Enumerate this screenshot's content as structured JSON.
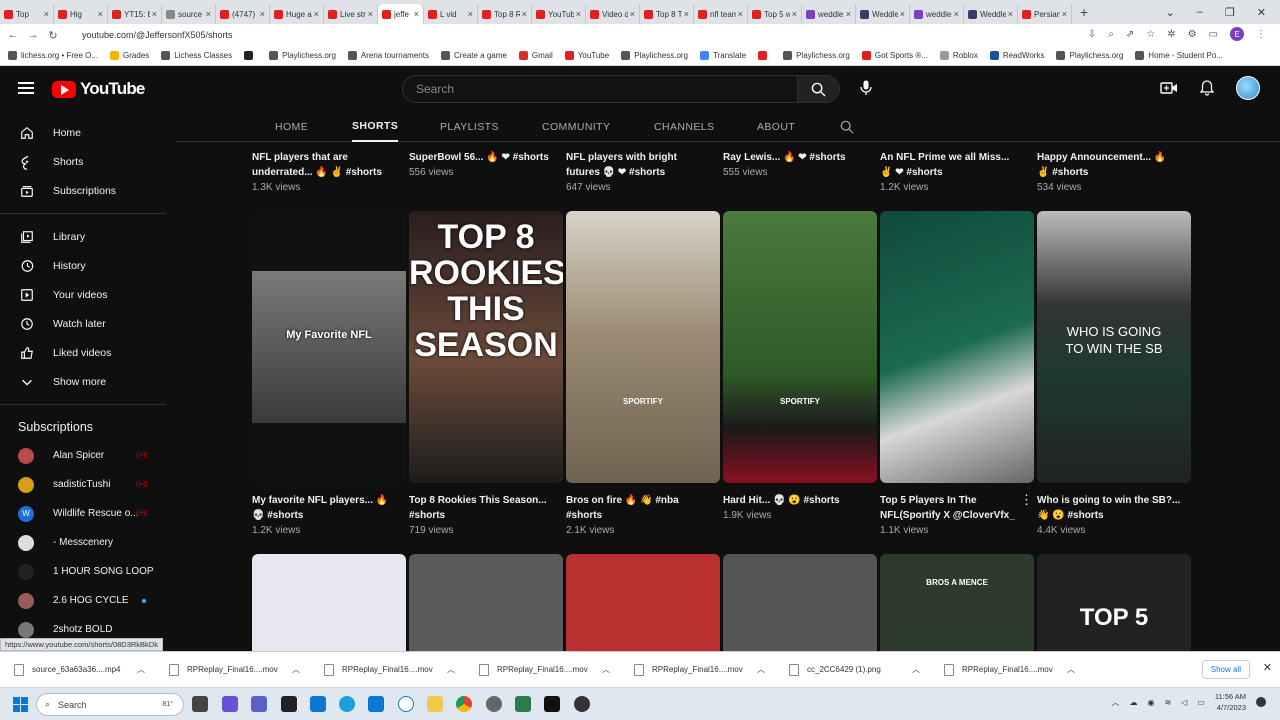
{
  "browser": {
    "tabs": [
      {
        "title": "Top",
        "color": "#e02020"
      },
      {
        "title": "Hig",
        "color": "#e02020"
      },
      {
        "title": "YT15: E",
        "color": "#e02020"
      },
      {
        "title": "source",
        "color": "#888888"
      },
      {
        "title": "(4747)",
        "color": "#e02020"
      },
      {
        "title": "Huge a",
        "color": "#e02020"
      },
      {
        "title": "Live stre",
        "color": "#e02020"
      },
      {
        "title": "jeffe",
        "color": "#e02020",
        "active": true
      },
      {
        "title": "L vid",
        "color": "#e02020"
      },
      {
        "title": "Top 8 R",
        "color": "#e02020"
      },
      {
        "title": "YouTub",
        "color": "#e02020"
      },
      {
        "title": "Video d",
        "color": "#e02020"
      },
      {
        "title": "Top 8 T",
        "color": "#e02020"
      },
      {
        "title": "nfl team",
        "color": "#e02020"
      },
      {
        "title": "Top 5 w",
        "color": "#e02020"
      },
      {
        "title": "weddle",
        "color": "#7b3fc6"
      },
      {
        "title": "Weddle",
        "color": "#3b3b6b"
      },
      {
        "title": "weddle",
        "color": "#7b3fc6"
      },
      {
        "title": "Weddle",
        "color": "#3b3b6b"
      },
      {
        "title": "Persian",
        "color": "#e02020"
      }
    ],
    "url": "youtube.com/@JeffersonfX505/shorts",
    "profile_initial": "E",
    "bookmarks": [
      {
        "label": "lichess.org • Free O...",
        "color": "#555555"
      },
      {
        "label": "Grades",
        "color": "#f4b400"
      },
      {
        "label": "Lichess Classes",
        "color": "#555555"
      },
      {
        "label": "",
        "color": "#222222"
      },
      {
        "label": "Playlichess.org",
        "color": "#555555"
      },
      {
        "label": "Arena tournaments",
        "color": "#555555"
      },
      {
        "label": "Create a game",
        "color": "#555555"
      },
      {
        "label": "Gmail",
        "color": "#d93025"
      },
      {
        "label": "YouTube",
        "color": "#e02020"
      },
      {
        "label": "Playlichess.org",
        "color": "#555555"
      },
      {
        "label": "Translate",
        "color": "#4285f4"
      },
      {
        "label": "",
        "color": "#e02020"
      },
      {
        "label": "Playlichess.org",
        "color": "#555555"
      },
      {
        "label": "Got Sports ®...",
        "color": "#e02020"
      },
      {
        "label": "Roblox",
        "color": "#999999"
      },
      {
        "label": "ReadWorks",
        "color": "#1a4f9c"
      },
      {
        "label": "Playlichess.org",
        "color": "#555555"
      },
      {
        "label": "Home - Student Po...",
        "color": "#555555"
      }
    ]
  },
  "youtube": {
    "logo_text": "YouTube",
    "search_placeholder": "Search",
    "sidebar": {
      "main": [
        {
          "label": "Home",
          "icon": "home-icon"
        },
        {
          "label": "Shorts",
          "icon": "shorts-icon"
        },
        {
          "label": "Subscriptions",
          "icon": "subscriptions-icon"
        }
      ],
      "library": [
        {
          "label": "Library",
          "icon": "library-icon"
        },
        {
          "label": "History",
          "icon": "history-icon"
        },
        {
          "label": "Your videos",
          "icon": "your-videos-icon"
        },
        {
          "label": "Watch later",
          "icon": "watch-later-icon"
        },
        {
          "label": "Liked videos",
          "icon": "liked-videos-icon"
        },
        {
          "label": "Show more",
          "icon": "chevron-down-icon"
        }
      ],
      "subscriptions_title": "Subscriptions",
      "subscriptions": [
        {
          "name": "Alan Spicer",
          "color": "#b84a4a",
          "live": true
        },
        {
          "name": "sadisticTushi",
          "color": "#d4a017",
          "live": true
        },
        {
          "name": "Wildlife Rescue o...",
          "color": "#1e6fd9",
          "live": true,
          "initial": "W"
        },
        {
          "name": "- Messcenery",
          "color": "#dddddd",
          "live": false
        },
        {
          "name": "1 HOUR SONG LOOP",
          "color": "#222222",
          "live": false
        },
        {
          "name": "2.6 HOG CYCLE",
          "color": "#9a5a5a",
          "live": false,
          "dot": true
        },
        {
          "name": "2shotz BOLD",
          "color": "#777777",
          "live": false
        }
      ]
    },
    "channel_tabs": [
      "HOME",
      "SHORTS",
      "PLAYLISTS",
      "COMMUNITY",
      "CHANNELS",
      "ABOUT"
    ],
    "active_tab": "SHORTS",
    "row1": [
      {
        "title1": "NFL players that are",
        "title2": "underrated... 🔥 ✌ #shorts",
        "views": "1.3K views"
      },
      {
        "title1": "SuperBowl 56... 🔥 ❤ #shorts",
        "title2": "",
        "views": "556 views"
      },
      {
        "title1": "NFL players with bright",
        "title2": "futures 💀 ❤ #shorts",
        "views": "647 views"
      },
      {
        "title1": "Ray Lewis... 🔥 ❤ #shorts",
        "title2": "",
        "views": "555 views"
      },
      {
        "title1": "An NFL Prime we all Miss...",
        "title2": "✌ ❤ #shorts",
        "views": "1.2K views"
      },
      {
        "title1": "Happy Announcement... 🔥",
        "title2": "✌ #shorts",
        "views": "534 views"
      }
    ],
    "row2": [
      {
        "title1": "My favorite NFL players... 🔥",
        "title2": "💀 #shorts",
        "views": "1.2K views",
        "overlay": "My Favorite NFL",
        "bg": "#6b6b6b"
      },
      {
        "title1": "Top 8 Rookies This Season...",
        "title2": "#shorts",
        "views": "719 views",
        "overlay": "TOP 8 ROOKIES THIS SEASON",
        "bg": "#3a2a2a"
      },
      {
        "title1": "Bros on fire 🔥 👋 #nba",
        "title2": "#shorts",
        "views": "2.1K views",
        "overlay": "SPORTIFY",
        "bg": "#8a7a66"
      },
      {
        "title1": "Hard Hit... 💀 😮 #shorts",
        "title2": "",
        "views": "1.9K views",
        "overlay": "SPORTIFY",
        "bg": "#3d6b3a"
      },
      {
        "title1": "Top 5 Players In The",
        "title2": "NFL(Sportify X @CloverVfx_",
        "views": "1.1K views",
        "overlay": "",
        "bg": "#1d5a4a"
      },
      {
        "title1": "Who is going to win the SB?...",
        "title2": "👋 😮 #shorts",
        "views": "4.4K views",
        "overlay": "WHO IS GOING TO WIN THE SB",
        "bg": "#2a3a36"
      }
    ],
    "row3_bgs": [
      "#e8e6f0",
      "#5a5a5a",
      "#b83030",
      "#555555",
      "#2d3b2d",
      "#222222"
    ],
    "row3_overlays": [
      "",
      "",
      "",
      "",
      "BROS A MENCE",
      "TOP 5"
    ]
  },
  "status_url": "https://www.youtube.com/shorts/08D3RkBkDk",
  "downloads": {
    "items": [
      "source_63a63a36....mp4",
      "RPReplay_Final16....mov",
      "RPReplay_Final16....mov",
      "RPReplay_Final16....mov",
      "RPReplay_Final16....mov",
      "cc_2CC6429 (1).png",
      "RPReplay_Final16....mov"
    ],
    "show_all": "Show all"
  },
  "taskbar": {
    "search_placeholder": "Search",
    "time": "11:56 AM",
    "date": "4/7/2023",
    "weather": "81°"
  }
}
